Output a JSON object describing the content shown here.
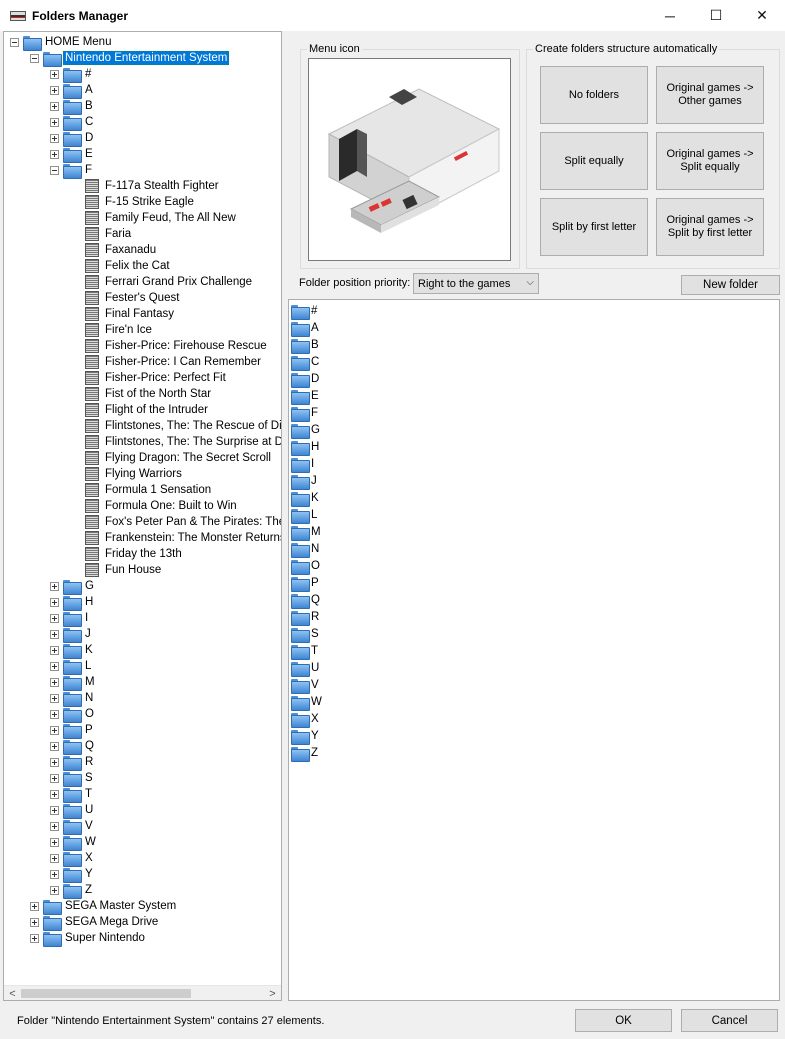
{
  "window": {
    "title": "Folders Manager",
    "minimize": "─",
    "maximize": "☐",
    "close": "✕"
  },
  "tree": {
    "root": "HOME Menu",
    "selected_system": "Nintendo Entertainment System",
    "letters_before": [
      "#",
      "A",
      "B",
      "C",
      "D",
      "E"
    ],
    "expanded_letter": "F",
    "games": [
      "F-117a Stealth Fighter",
      "F-15 Strike Eagle",
      "Family Feud, The All New",
      "Faria",
      "Faxanadu",
      "Felix the Cat",
      "Ferrari Grand Prix Challenge",
      "Fester's Quest",
      "Final Fantasy",
      "Fire'n Ice",
      "Fisher-Price: Firehouse Rescue",
      "Fisher-Price: I Can Remember",
      "Fisher-Price: Perfect Fit",
      "Fist of the North Star",
      "Flight of the Intruder",
      "Flintstones, The: The Rescue of Dino",
      "Flintstones, The: The Surprise at Dino",
      "Flying Dragon: The Secret Scroll",
      "Flying Warriors",
      "Formula 1 Sensation",
      "Formula One: Built to Win",
      "Fox's Peter Pan & The Pirates: The R",
      "Frankenstein: The Monster Returns",
      "Friday the 13th",
      "Fun House"
    ],
    "letters_after": [
      "G",
      "H",
      "I",
      "J",
      "K",
      "L",
      "M",
      "N",
      "O",
      "P",
      "Q",
      "R",
      "S",
      "T",
      "U",
      "V",
      "W",
      "X",
      "Y",
      "Z"
    ],
    "other_systems": [
      "SEGA Master System",
      "SEGA Mega Drive",
      "Super Nintendo"
    ]
  },
  "menu_icon": {
    "label": "Menu icon"
  },
  "auto_structure": {
    "label": "Create folders structure automatically",
    "buttons": [
      "No folders",
      "Original games ->\nOther games",
      "Split equally",
      "Original games ->\nSplit equally",
      "Split by first letter",
      "Original games ->\nSplit by first letter"
    ]
  },
  "priority": {
    "label": "Folder position priority:",
    "value": "Right to the games"
  },
  "new_folder_label": "New folder",
  "folder_list": [
    "#",
    "A",
    "B",
    "C",
    "D",
    "E",
    "F",
    "G",
    "H",
    "I",
    "J",
    "K",
    "L",
    "M",
    "N",
    "O",
    "P",
    "Q",
    "R",
    "S",
    "T",
    "U",
    "V",
    "W",
    "X",
    "Y",
    "Z"
  ],
  "status_text": "Folder \"Nintendo Entertainment System\" contains 27 elements.",
  "ok_label": "OK",
  "cancel_label": "Cancel"
}
